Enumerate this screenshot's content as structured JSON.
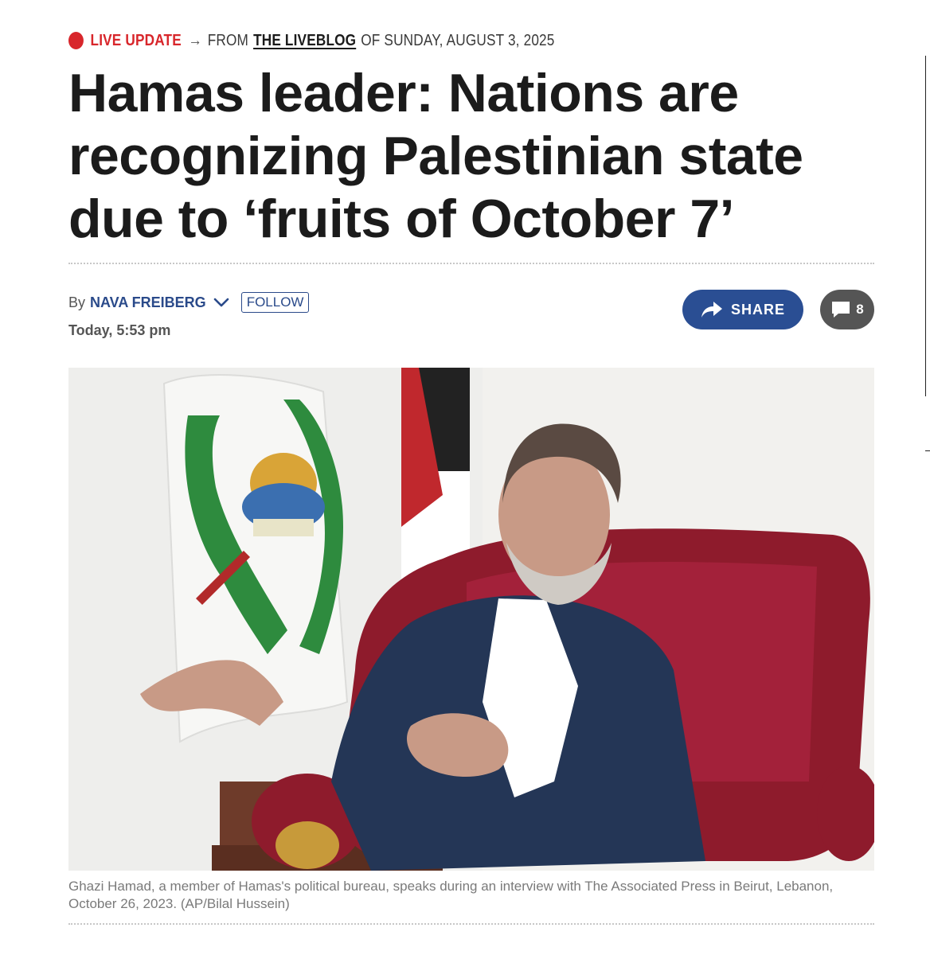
{
  "live_update": {
    "label": "LIVE UPDATE",
    "arrow": "→",
    "from_text": "FROM",
    "liveblog_link": "THE LIVEBLOG",
    "date_text": "OF SUNDAY, AUGUST 3, 2025"
  },
  "headline": {
    "line1": "Hamas leader: Nations are",
    "line2": "recognizing Palestinian state",
    "line3": "due to ‘fruits of October 7’"
  },
  "byline": {
    "by_text": "By",
    "author": "NAVA FREIBERG",
    "follow_label": "FOLLOW",
    "timestamp": "Today, 5:53 pm"
  },
  "actions": {
    "share_label": "SHARE",
    "comment_count": "8"
  },
  "photo": {
    "caption": "Ghazi Hamad, a member of Hamas's political bureau, speaks during an interview with The Associated Press in Beirut, Lebanon, October 26, 2023. (AP/Bilal Hussein)"
  },
  "colors": {
    "live_red": "#d8262b",
    "link_blue": "#2a4a8a",
    "share_blue": "#2a4e93",
    "comment_gray": "#555555"
  },
  "icons": [
    "live-dot-icon",
    "chevron-down-icon",
    "share-arrow-icon",
    "comment-bubble-icon"
  ]
}
